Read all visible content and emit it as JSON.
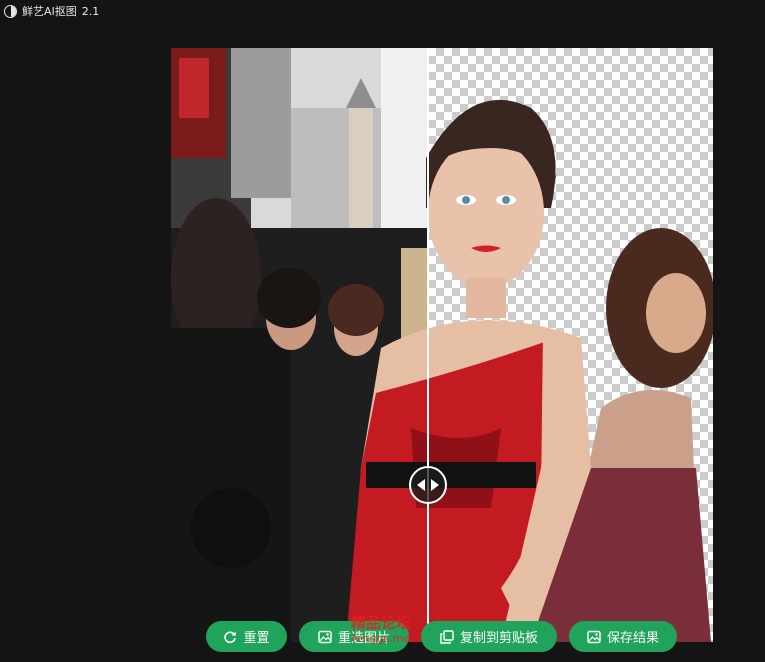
{
  "app": {
    "title": "鲜艺AI抠图",
    "version": "2.1"
  },
  "viewer": {
    "split_fraction": 0.475
  },
  "actions": {
    "reset_label": "重置",
    "reselect_label": "重选图片",
    "copy_label": "复制到剪贴板",
    "save_label": "保存结果"
  },
  "watermark": {
    "line1": "精品论坛",
    "line2": "fenggs.me"
  },
  "colors": {
    "background": "#141414",
    "button_green": "#20a35a",
    "checker_dark": "#cccccc",
    "checker_light": "#ffffff"
  }
}
